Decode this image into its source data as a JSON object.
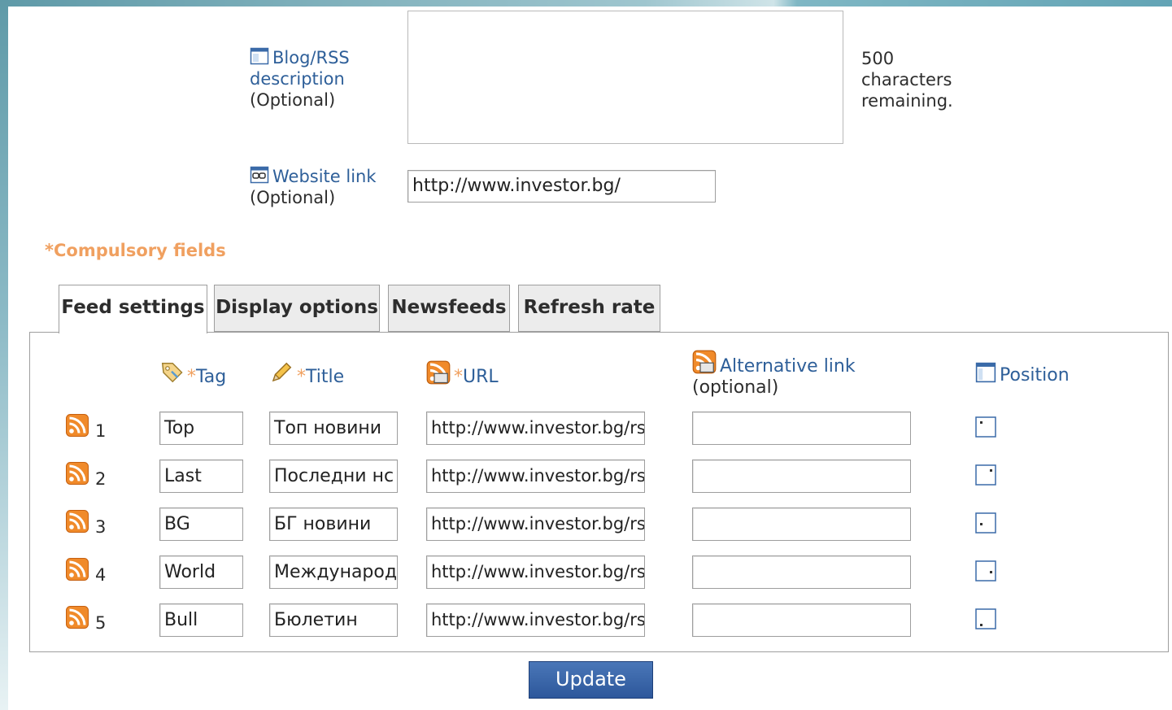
{
  "blog_description": {
    "label": "Blog/RSS description",
    "label_line1": "Blog/RSS",
    "label_line2": "description",
    "optional": "(Optional)",
    "value": "",
    "counter_line1": "500",
    "counter_line2": "characters",
    "counter_line3": "remaining."
  },
  "website_link": {
    "label": "Website link",
    "optional": "(Optional)",
    "value": "http://www.investor.bg/"
  },
  "compulsory_note": "*Compulsory fields",
  "tabs": [
    {
      "label": "Feed settings",
      "active": true
    },
    {
      "label": "Display options",
      "active": false
    },
    {
      "label": "Newsfeeds",
      "active": false
    },
    {
      "label": "Refresh rate",
      "active": false
    }
  ],
  "table": {
    "headers": {
      "tag": "Tag",
      "title": "Title",
      "url": "URL",
      "alt_link": "Alternative link",
      "alt_optional": "(optional)",
      "position": "Position",
      "asterisk": "*"
    },
    "rows": [
      {
        "num": "1",
        "tag": "Top",
        "title": "Топ новини",
        "url": "http://www.investor.bg/rs",
        "alt": "",
        "position": "top-left"
      },
      {
        "num": "2",
        "tag": "Last",
        "title": "Последни нс",
        "url": "http://www.investor.bg/rs",
        "alt": "",
        "position": "top-right"
      },
      {
        "num": "3",
        "tag": "BG",
        "title": "БГ новини",
        "url": "http://www.investor.bg/rs",
        "alt": "",
        "position": "middle-left"
      },
      {
        "num": "4",
        "tag": "World",
        "title": "Международ",
        "url": "http://www.investor.bg/rs",
        "alt": "",
        "position": "middle-right"
      },
      {
        "num": "5",
        "tag": "Bull",
        "title": "Бюлетин",
        "url": "http://www.investor.bg/rs",
        "alt": "",
        "position": "bottom-left"
      }
    ]
  },
  "update_label": "Update",
  "colors": {
    "link_blue": "#2e5f99",
    "accent_orange": "#f0a060",
    "button_blue": "#2d579b"
  },
  "icons": {
    "description": "window-icon",
    "website": "link-window-icon",
    "tag": "tag-icon",
    "title": "pencil-icon",
    "url": "rss-link-icon",
    "alt": "rss-link-icon",
    "position": "layout-icon",
    "row": "rss-feed-icon"
  }
}
